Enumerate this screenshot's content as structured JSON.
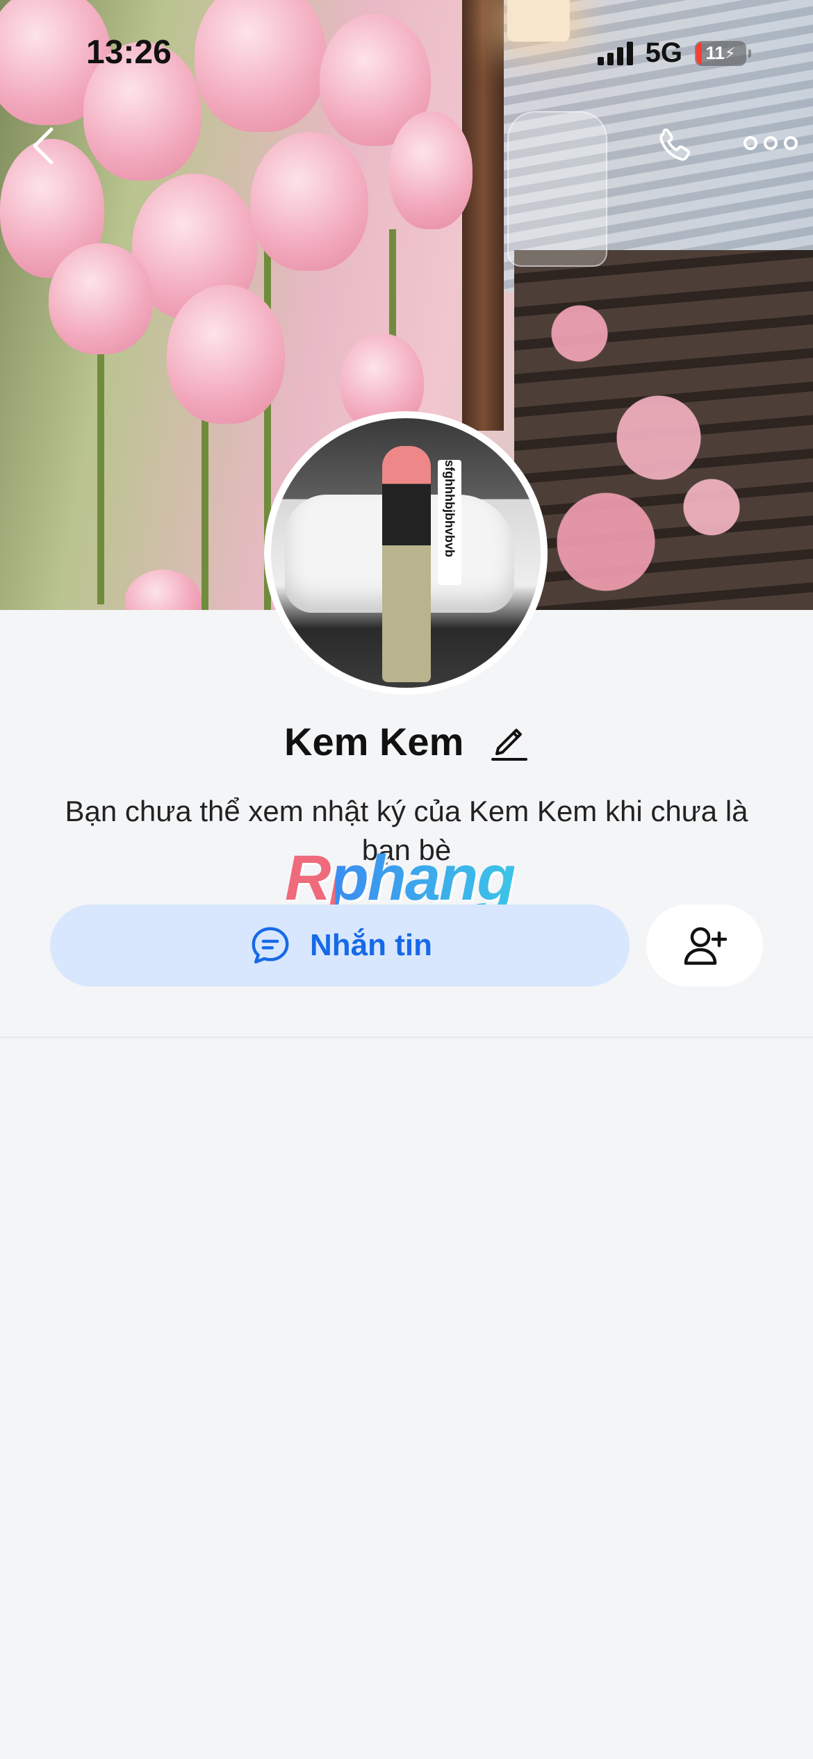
{
  "status_bar": {
    "time": "13:26",
    "network": "5G",
    "battery": "11"
  },
  "header": {
    "back_icon": "chevron-left-icon",
    "call_icon": "phone-icon",
    "more_icon": "more-horizontal-icon"
  },
  "profile": {
    "name": "Kem Kem",
    "edit_icon": "pencil-icon",
    "notice": "Bạn chưa thể xem nhật ký của Kem Kem khi chưa là bạn bè",
    "avatar_tag": "sfghhhbjbhvbvb"
  },
  "watermark": "Rphang",
  "actions": {
    "message_label": "Nhắn tin",
    "message_icon": "chat-bubble-icon",
    "add_friend_icon": "add-user-icon"
  },
  "colors": {
    "accent": "#1769e8",
    "message_button_bg": "#d8e7fd",
    "page_bg": "#f4f5f7"
  }
}
